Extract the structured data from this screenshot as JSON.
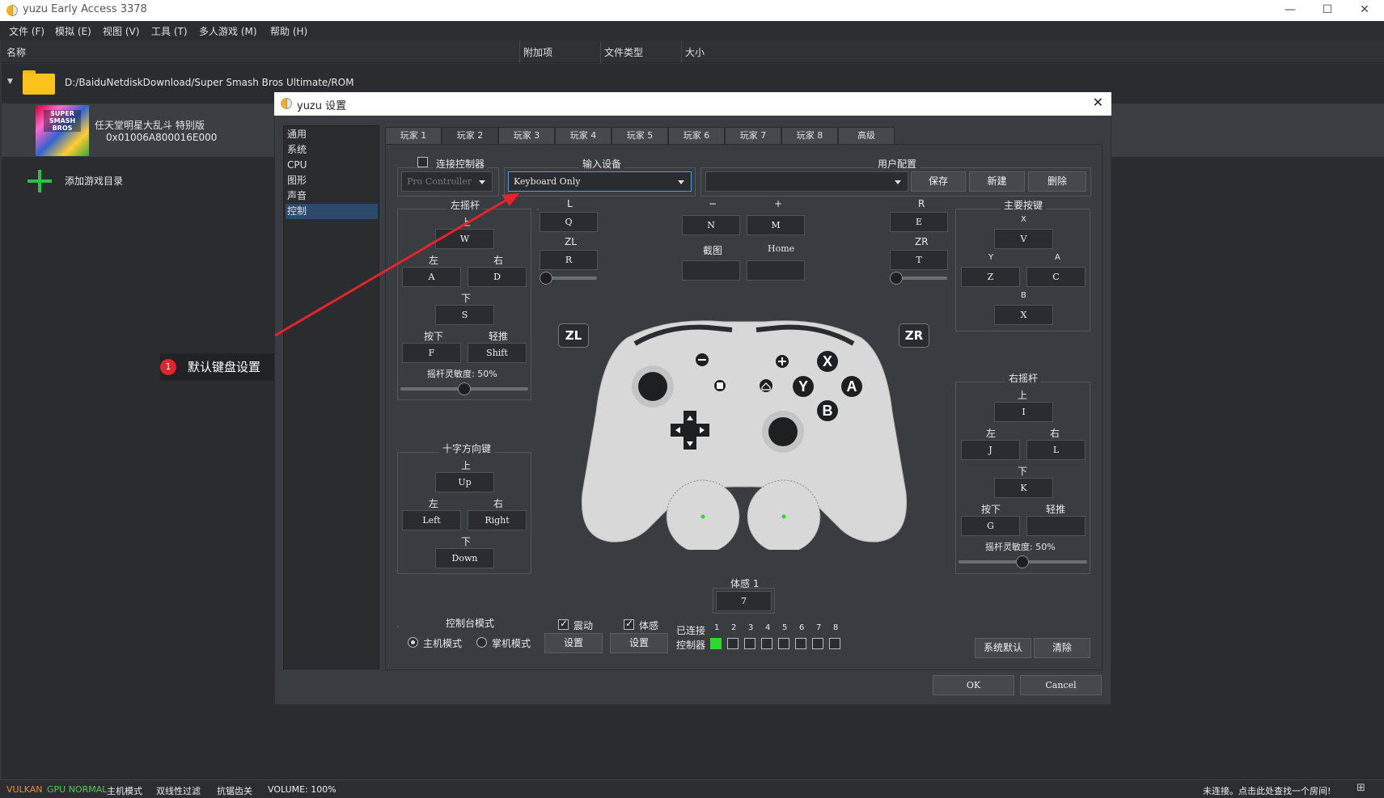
{
  "window": {
    "title": "yuzu Early Access 3378",
    "minimize": "—",
    "maximize": "☐",
    "close": "✕"
  },
  "menu": [
    "文件 (F)",
    "模拟 (E)",
    "视图 (V)",
    "工具 (T)",
    "多人游戏 (M)",
    "帮助 (H)"
  ],
  "columns": {
    "name": "名称",
    "addons": "附加项",
    "filetype": "文件类型",
    "size": "大小"
  },
  "folder": {
    "path": "D:/BaiduNetdiskDownload/Super Smash Bros Ultimate/ROM"
  },
  "game": {
    "title": "任天堂明星大乱斗 特别版",
    "id": "0x01006A800016E000",
    "thumb_text": "SUPER SMASH BROS"
  },
  "add_dir": "添加游戏目录",
  "status": {
    "vulkan": "VULKAN",
    "gpu": "GPU NORMAL",
    "mode": "主机模式",
    "filter": "双线性过滤",
    "aa": "抗锯齿关",
    "volume": "VOLUME: 100%",
    "room": "未连接。点击此处查找一个房间!"
  },
  "dialog": {
    "title": "yuzu 设置",
    "close": "✕",
    "nav": [
      "通用",
      "系统",
      "CPU",
      "图形",
      "声音",
      "控制"
    ],
    "tabs": [
      "玩家 1",
      "玩家 2",
      "玩家 3",
      "玩家 4",
      "玩家 5",
      "玩家 6",
      "玩家 7",
      "玩家 8",
      "高级"
    ],
    "connect_controller": "连接控制器",
    "controller_type": "Pro Controller",
    "input_device_label": "输入设备",
    "input_device": "Keyboard Only",
    "profile_label": "用户配置",
    "profile_value": "",
    "save": "保存",
    "new": "新建",
    "delete": "删除",
    "left_stick": {
      "title": "左摇杆",
      "up_l": "上",
      "up": "W",
      "left_l": "左",
      "left": "A",
      "right_l": "右",
      "right": "D",
      "down_l": "下",
      "down": "S",
      "press_l": "按下",
      "press": "F",
      "mod_l": "轻推",
      "mod": "Shift",
      "sens": "摇杆灵敏度: 50%"
    },
    "l": {
      "label": "L",
      "key": "Q"
    },
    "zl": {
      "label": "ZL",
      "key": "R"
    },
    "minus": {
      "label": "−",
      "key": "N"
    },
    "plus": {
      "label": "+",
      "key": "M"
    },
    "capture": {
      "label": "截图",
      "key": ""
    },
    "home": {
      "label": "Home",
      "key": ""
    },
    "r": {
      "label": "R",
      "key": "E"
    },
    "zr": {
      "label": "ZR",
      "key": "T"
    },
    "face": {
      "title": "主要按键",
      "x_l": "X",
      "x": "V",
      "y_l": "Y",
      "y": "Z",
      "a_l": "A",
      "a": "C",
      "b_l": "B",
      "b": "X"
    },
    "dpad": {
      "title": "十字方向键",
      "up_l": "上",
      "up": "Up",
      "left_l": "左",
      "left": "Left",
      "right_l": "右",
      "right": "Right",
      "down_l": "下",
      "down": "Down"
    },
    "right_stick": {
      "title": "右摇杆",
      "up_l": "上",
      "up": "I",
      "left_l": "左",
      "left": "J",
      "right_l": "右",
      "right": "L",
      "down_l": "下",
      "down": "K",
      "press_l": "按下",
      "press": "G",
      "mod_l": "轻推",
      "mod": "",
      "sens": "摇杆灵敏度: 50%"
    },
    "motion": {
      "label": "体感 1",
      "key": "7"
    },
    "controller_art": {
      "zl": "ZL",
      "zr": "ZR",
      "x": "X",
      "y": "Y",
      "a": "A",
      "b": "B",
      "minus": "−",
      "plus": "+"
    },
    "console_mode": {
      "title": "控制台模式",
      "docked": "主机模式",
      "handheld": "掌机模式"
    },
    "vibration": {
      "label": "震动",
      "button": "设置"
    },
    "motion_cfg": {
      "label": "体感",
      "button": "设置"
    },
    "connected_label": "已连接",
    "controller_label": "控制器",
    "player_numbers": [
      "1",
      "2",
      "3",
      "4",
      "5",
      "6",
      "7",
      "8"
    ],
    "defaults": "系统默认",
    "clear": "清除",
    "ok": "OK",
    "cancel": "Cancel"
  },
  "annotation": {
    "number": "1",
    "text": "默认键盘设置"
  },
  "colors": {
    "accent_green": "#2ed82e",
    "annotation_red": "#e3242b",
    "selection": "#2c4a6b"
  }
}
